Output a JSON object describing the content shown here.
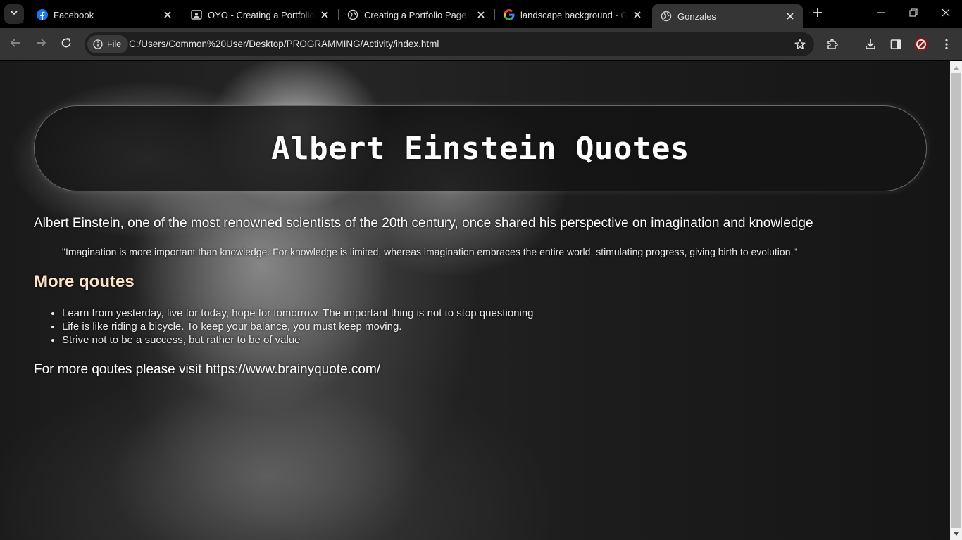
{
  "browser": {
    "tabs": [
      {
        "title": "Facebook",
        "icon": "facebook-icon",
        "active": false
      },
      {
        "title": "OYO - Creating a Portfolio Page",
        "icon": "classroom-icon",
        "active": false
      },
      {
        "title": "Creating a Portfolio Page",
        "icon": "globe-icon",
        "active": false
      },
      {
        "title": "landscape background - Google Search",
        "icon": "google-icon",
        "active": false
      },
      {
        "title": "Gonzales",
        "icon": "globe-icon",
        "active": true
      }
    ],
    "chip_label": "File",
    "url": "C:/Users/Common%20User/Desktop/PROGRAMMING/Activity/index.html",
    "colors": {
      "tab_bg": "#000000",
      "toolbar_bg": "#353535",
      "omnibox_bg": "#1f1f1f",
      "facebook_blue": "#1877f2"
    }
  },
  "page": {
    "heading": "Albert Einstein Quotes",
    "intro": "Albert Einstein, one of the most renowned scientists of the 20th century, once shared his perspective on imagination and knowledge",
    "quote": "\"Imagination is more important than knowledge. For knowledge is limited, whereas imagination embraces the entire world, stimulating progress, giving birth to evolution.\"",
    "more_title": "More qoutes",
    "quotes": [
      "Learn from yesterday, live for today, hope for tomorrow. The important thing is not to stop questioning",
      "Life is like riding a bicycle. To keep your balance, you must keep moving.",
      "Strive not to be a success, but rather to be of value"
    ],
    "visit": "For more qoutes please visit https://www.brainyquote.com/",
    "colors": {
      "heading_text": "#ffffff",
      "subheading_text": "#ffe3c8",
      "body_text": "#ececec"
    }
  }
}
